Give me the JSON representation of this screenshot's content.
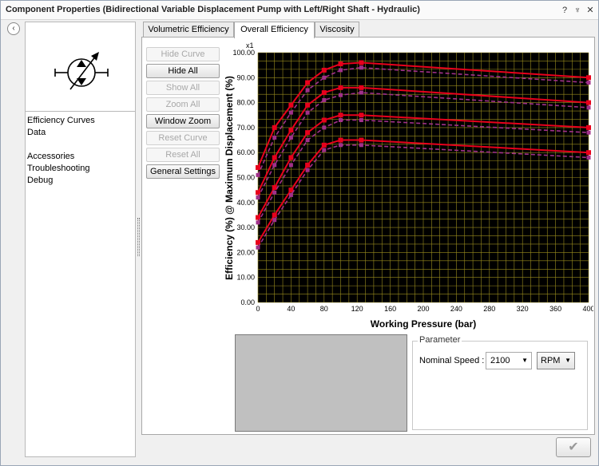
{
  "window": {
    "title": "Component Properties (Bidirectional Variable Displacement Pump with Left/Right Shaft - Hydraulic)",
    "controls": {
      "help": "?",
      "pin": "♆",
      "close": "✕"
    }
  },
  "sidebar": {
    "collapse_glyph": "‹",
    "items": [
      {
        "label": "Efficiency Curves"
      },
      {
        "label": "Data"
      },
      {
        "label": "Accessories"
      },
      {
        "label": "Troubleshooting"
      },
      {
        "label": "Debug"
      }
    ]
  },
  "tabs": [
    {
      "label": "Volumetric Efficiency",
      "active": false
    },
    {
      "label": "Overall Efficiency",
      "active": true
    },
    {
      "label": "Viscosity",
      "active": false
    }
  ],
  "buttons": {
    "hide_curve": "Hide Curve",
    "hide_all": "Hide All",
    "show_all": "Show All",
    "zoom_all": "Zoom All",
    "window_zoom": "Window Zoom",
    "reset_curve": "Reset Curve",
    "reset_all": "Reset All",
    "general_settings": "General Settings"
  },
  "parameter": {
    "legend": "Parameter",
    "speed_label": "Nominal Speed :",
    "speed_value": "2100",
    "unit_value": "RPM"
  },
  "ok_glyph": "✔",
  "chart_data": {
    "type": "line",
    "xlabel": "Working Pressure (bar)",
    "ylabel": "Efficiency (%) @ Maximum Displacement (%)",
    "y_multiplier": "x1",
    "xlim": [
      0,
      400
    ],
    "ylim": [
      0,
      100
    ],
    "x_ticks": [
      0,
      40,
      80,
      120,
      160,
      200,
      240,
      280,
      320,
      360,
      400
    ],
    "y_ticks": [
      "0.00",
      "10.00",
      "20.00",
      "30.00",
      "40.00",
      "50.00",
      "60.00",
      "70.00",
      "80.00",
      "90.00",
      "100.00"
    ],
    "grid": true,
    "background": "#000000",
    "grid_color": "#9a8c1e",
    "series": [
      {
        "style": "solid",
        "color": "#e8001c",
        "x": [
          0,
          20,
          40,
          60,
          80,
          100,
          125,
          400
        ],
        "y": [
          54,
          70,
          79,
          88,
          93,
          95.5,
          96,
          90
        ]
      },
      {
        "style": "dashed",
        "color": "#a0308a",
        "x": [
          0,
          20,
          40,
          60,
          80,
          100,
          125,
          400
        ],
        "y": [
          51,
          66,
          76,
          85,
          90,
          93,
          94,
          88
        ]
      },
      {
        "style": "solid",
        "color": "#e8001c",
        "x": [
          0,
          20,
          40,
          60,
          80,
          100,
          125,
          400
        ],
        "y": [
          44,
          58,
          69,
          79,
          84,
          86,
          86,
          80
        ]
      },
      {
        "style": "dashed",
        "color": "#a0308a",
        "x": [
          0,
          20,
          40,
          60,
          80,
          100,
          125,
          400
        ],
        "y": [
          42,
          55,
          66,
          76,
          81,
          83,
          84,
          78
        ]
      },
      {
        "style": "solid",
        "color": "#e8001c",
        "x": [
          0,
          20,
          40,
          60,
          80,
          100,
          125,
          400
        ],
        "y": [
          34,
          46,
          58,
          68,
          73,
          75,
          75,
          70
        ]
      },
      {
        "style": "dashed",
        "color": "#a0308a",
        "x": [
          0,
          20,
          40,
          60,
          80,
          100,
          125,
          400
        ],
        "y": [
          32,
          44,
          55,
          65,
          70,
          73,
          73,
          68
        ]
      },
      {
        "style": "solid",
        "color": "#e8001c",
        "x": [
          0,
          20,
          40,
          60,
          80,
          100,
          125,
          400
        ],
        "y": [
          24,
          35,
          45,
          55,
          63,
          65,
          65,
          60
        ]
      },
      {
        "style": "dashed",
        "color": "#a0308a",
        "x": [
          0,
          20,
          40,
          60,
          80,
          100,
          125,
          400
        ],
        "y": [
          22,
          33,
          43,
          53,
          61,
          63,
          63,
          58
        ]
      }
    ]
  }
}
